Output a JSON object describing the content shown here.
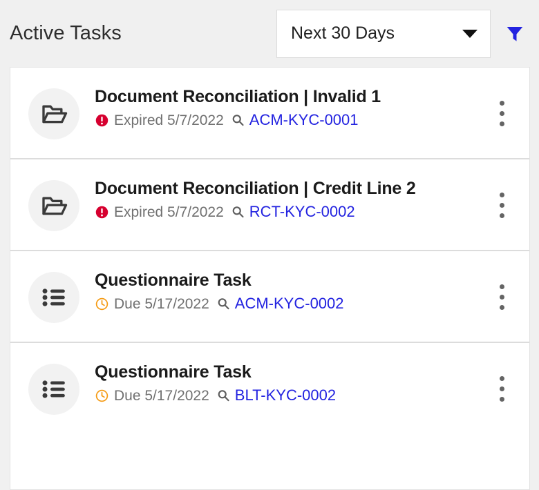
{
  "header": {
    "title": "Active Tasks",
    "range_filter": {
      "selected": "Next 30 Days",
      "caret_icon": "chevron-down-icon"
    },
    "filter_icon": "filter-funnel-icon",
    "filter_color": "#2323e0"
  },
  "colors": {
    "page_background": "#f0f0f0",
    "card_background": "#ffffff",
    "link": "#2323e0",
    "overdue": "#d6002f",
    "due": "#f59b14",
    "divider": "#dcdcdc"
  },
  "tasks": [
    {
      "type_icon": "open-folder-icon",
      "title": "Document Reconciliation | Invalid 1",
      "status_icon": "alert-exclamation-icon",
      "status_text": "Expired 5/7/2022",
      "search_icon": "magnifier-icon",
      "link": "ACM-KYC-0001",
      "menu_icon": "more-vertical-icon"
    },
    {
      "type_icon": "open-folder-icon",
      "title": "Document Reconciliation | Credit Line 2",
      "status_icon": "alert-exclamation-icon",
      "status_text": "Expired 5/7/2022",
      "search_icon": "magnifier-icon",
      "link": "RCT-KYC-0002",
      "menu_icon": "more-vertical-icon"
    },
    {
      "type_icon": "checklist-icon",
      "title": "Questionnaire Task",
      "status_icon": "clock-icon",
      "status_text": "Due 5/17/2022",
      "search_icon": "magnifier-icon",
      "link": "ACM-KYC-0002",
      "menu_icon": "more-vertical-icon"
    },
    {
      "type_icon": "checklist-icon",
      "title": "Questionnaire Task",
      "status_icon": "clock-icon",
      "status_text": "Due 5/17/2022",
      "search_icon": "magnifier-icon",
      "link": "BLT-KYC-0002",
      "menu_icon": "more-vertical-icon"
    }
  ]
}
